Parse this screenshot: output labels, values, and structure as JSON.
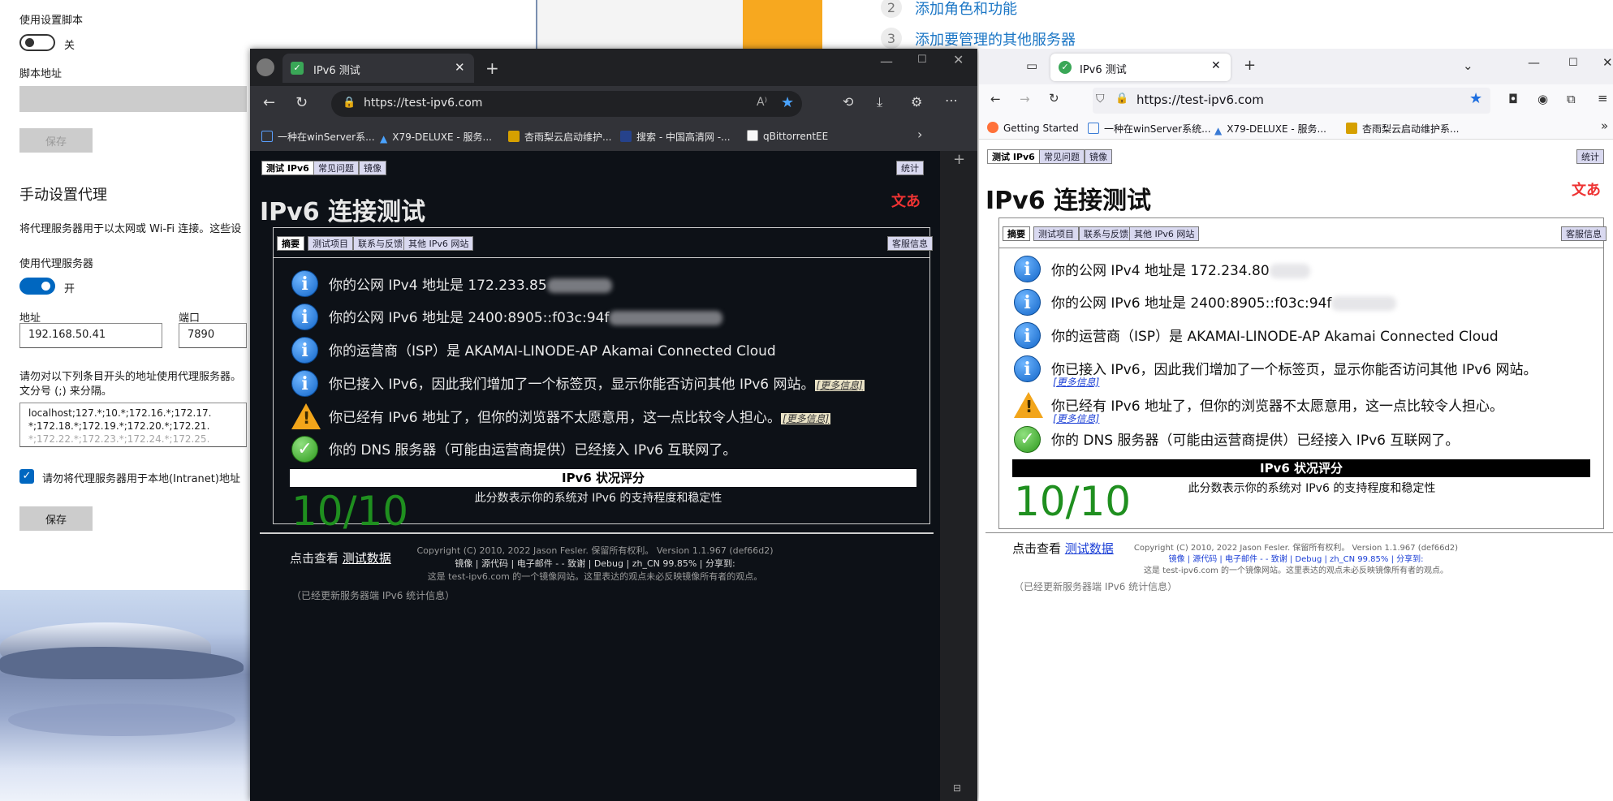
{
  "settings": {
    "script_label": "使用设置脚本",
    "script_toggle": "关",
    "script_addr_label": "脚本地址",
    "save1": "保存",
    "manual_title": "手动设置代理",
    "manual_desc": "将代理服务器用于以太网或 Wi-Fi 连接。这些设",
    "use_proxy_label": "使用代理服务器",
    "use_proxy_toggle": "开",
    "addr_label": "地址",
    "port_label": "端口",
    "addr_value": "192.168.50.41",
    "port_value": "7890",
    "exclude_desc1": "请勿对以下列条目开头的地址使用代理服务器。",
    "exclude_desc2": "文分号 (;) 来分隔。",
    "exclude_line1": "localhost;127.*;10.*;172.16.*;172.17.",
    "exclude_line2": "*;172.18.*;172.19.*;172.20.*;172.21.",
    "exclude_line3": "*;172.22.*;172.23.*;172.24.*;172.25.",
    "local_checkbox": "请勿将代理服务器用于本地(Intranet)地址",
    "save2": "保存"
  },
  "server_manager": {
    "step2_num": "2",
    "step2": "添加角色和功能",
    "step3_num": "3",
    "step3": "添加要管理的其他服务器"
  },
  "edge": {
    "tab_title": "IPv6 测试",
    "url": "https://test-ipv6.com",
    "favorites": [
      "一种在winServer系...",
      "X79-DELUXE - 服务...",
      "杏雨梨云启动维护...",
      "搜索 - 中国高清网 -...",
      "qBittorrentEE"
    ]
  },
  "firefox": {
    "tab_title": "IPv6 测试",
    "url": "https://test-ipv6.com",
    "favorites": [
      "Getting Started",
      "一种在winServer系统...",
      "X79-DELUXE - 服务...",
      "杏雨梨云启动维护系..."
    ]
  },
  "page": {
    "top_tabs": [
      "测试 IPv6",
      "常见问题",
      "镜像"
    ],
    "stats_tab": "统计",
    "heading": "IPv6 连接测试",
    "inner_tabs": [
      "摘要",
      "测试项目",
      "联系与反馈",
      "其他 IPv6 网站"
    ],
    "support_tab": "客服信息",
    "rows_edge": [
      "你的公网 IPv4 地址是 172.233.85",
      "你的公网 IPv6 地址是 2400:8905::f03c:94f",
      "你的运营商（ISP）是 AKAMAI-LINODE-AP Akamai Connected Cloud",
      "你已接入 IPv6，因此我们增加了一个标签页，显示你能否访问其他 IPv6 网站。",
      "你已经有 IPv6 地址了，但你的浏览器不太愿意用，这一点比较令人担心。",
      "你的 DNS 服务器（可能由运营商提供）已经接入 IPv6 互联网了。"
    ],
    "rows_ff": [
      "你的公网 IPv4 地址是 172.234.80",
      "你的公网 IPv6 地址是 2400:8905::f03c:94f",
      "你的运营商（ISP）是 AKAMAI-LINODE-AP Akamai Connected Cloud",
      "你已接入 IPv6，因此我们增加了一个标签页，显示你能否访问其他 IPv6 网站。",
      "你已经有 IPv6 地址了，但你的浏览器不太愿意用，这一点比较令人担心。",
      "你的 DNS 服务器（可能由运营商提供）已经接入 IPv6 互联网了。"
    ],
    "more_info": "[更多信息]",
    "score_title": "IPv6 状况评分",
    "score": "10/10",
    "score_desc": "此分数表示你的系统对 IPv6 的支持程度和稳定性",
    "view_prefix": "点击查看",
    "view_link": "测试数据",
    "stats_note": "（已经更新服务器端 IPv6 统计信息）",
    "copyright": "Copyright (C) 2010, 2022 Jason Fesler. 保留所有权利。 Version 1.1.967 (def66d2)",
    "footer_links": "镜像 | 源代码 | 电子邮件 -  - 致谢 | Debug | zh_CN 99.85% | 分享到:",
    "mirror_note": "这是 test-ipv6.com 的一个镜像网站。这里表达的观点未必反映镜像所有者的观点。"
  },
  "colors": {
    "accent": "#0067c0",
    "score_green": "#1f8f1f",
    "link_blue": "#1b76c5",
    "warn_orange": "#f2a51a"
  }
}
